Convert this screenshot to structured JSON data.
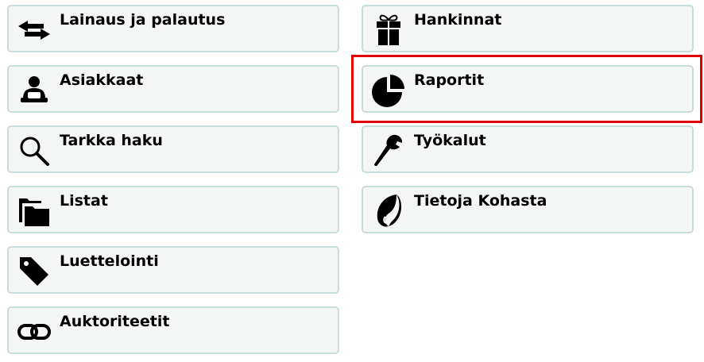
{
  "left_column": [
    {
      "label": "Lainaus ja palautus",
      "icon": "transfer-arrows-icon"
    },
    {
      "label": "Asiakkaat",
      "icon": "patron-icon"
    },
    {
      "label": "Tarkka haku",
      "icon": "search-icon"
    },
    {
      "label": "Listat",
      "icon": "folders-icon"
    },
    {
      "label": "Luettelointi",
      "icon": "tag-icon"
    },
    {
      "label": "Auktoriteetit",
      "icon": "link-icon"
    }
  ],
  "right_column": [
    {
      "label": "Hankinnat",
      "icon": "gift-icon"
    },
    {
      "label": "Raportit",
      "icon": "pie-chart-icon"
    },
    {
      "label": "Työkalut",
      "icon": "wrench-icon"
    },
    {
      "label": "Tietoja Kohasta",
      "icon": "koha-logo-icon"
    }
  ],
  "highlight": {
    "target": "Raportit",
    "color": "#e00000"
  }
}
